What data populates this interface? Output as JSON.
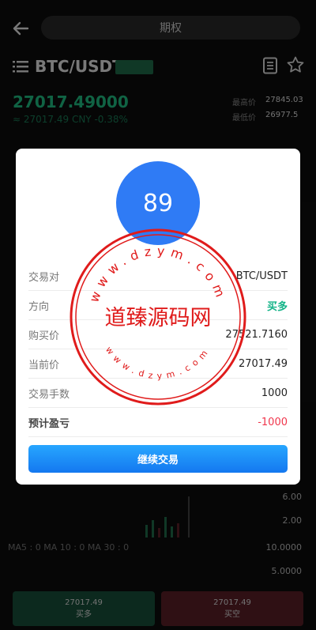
{
  "topbar": {
    "mode_label": "期权"
  },
  "pair": {
    "symbol": "BTC/USDT"
  },
  "ticker": {
    "price": "27017.49000",
    "sub": "≈ 27017.49 CNY  -0.38%",
    "stats": [
      {
        "label": "最高价",
        "value": "27845.03"
      },
      {
        "label": "最低价",
        "value": "26977.5"
      }
    ]
  },
  "chart_info": {
    "line": "MA5 : 0  MA 10 : 0  MA 30 : 0",
    "side_values": [
      "6.00",
      "2.00",
      "10.0000",
      "5.0000"
    ]
  },
  "trade_buttons": [
    {
      "price": "27017.49",
      "action": "买多",
      "color": "#184f3a"
    },
    {
      "price": "27017.49",
      "action": "买空",
      "color": "#5a1f28"
    }
  ],
  "dialog": {
    "score": "89",
    "rows": [
      {
        "label": "交易对",
        "value": "BTC/USDT"
      },
      {
        "label": "方向",
        "value": "买多"
      },
      {
        "label": "购买价",
        "value": "27521.7160"
      },
      {
        "label": "当前价",
        "value": "27017.49"
      },
      {
        "label": "交易手数",
        "value": "1000"
      },
      {
        "label": "预计盈亏",
        "value": "-1000"
      }
    ],
    "continue_label": "继续交易"
  },
  "watermark": {
    "site": "www.dzym.com",
    "text": "道臻源码网",
    "color": "#e01b1b"
  },
  "colors": {
    "accent": "#2f7bf5",
    "green": "#12b387",
    "red": "#f0364c"
  }
}
